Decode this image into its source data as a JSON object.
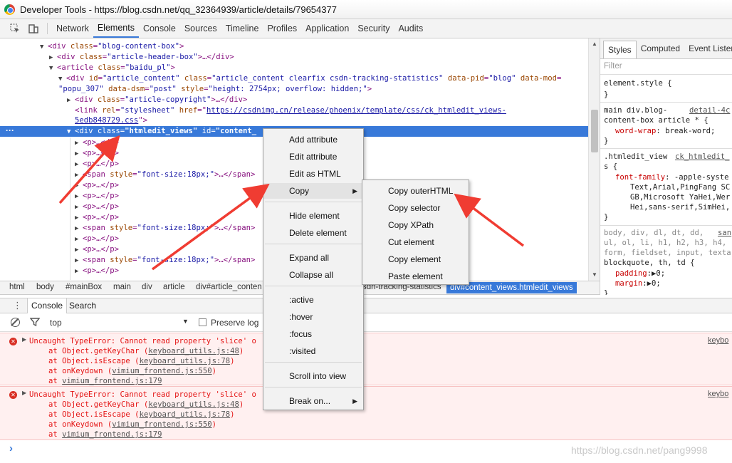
{
  "window": {
    "title": "Developer Tools - https://blog.csdn.net/qq_32364939/article/details/79654377"
  },
  "toolbar": {
    "inspect_icon": "inspect-arrow-icon",
    "device_icon": "device-mode-icon",
    "tabs": [
      "Network",
      "Elements",
      "Console",
      "Sources",
      "Timeline",
      "Profiles",
      "Application",
      "Security",
      "Audits"
    ],
    "active_tab": "Elements"
  },
  "dom": {
    "l0": {
      "tag": "<div ",
      "attr": "class",
      "val": "\"blog-content-box\"",
      "end": ">"
    },
    "l1": {
      "tag": "<div ",
      "attr": "class",
      "val": "\"article-header-box\"",
      "end": ">…</div>"
    },
    "l2": {
      "tag": "<article ",
      "attr": "class",
      "val": "\"baidu_pl\"",
      "end": ">"
    },
    "l3": {
      "tag": "<div ",
      "a1": "id",
      "v1": "\"article_content\"",
      "a2": "class",
      "v2": "\"article_content clearfix csdn-tracking-statistics\"",
      "a3": "data-pid",
      "v3": "\"blog\"",
      "a4": "data-mod",
      "v4": "="
    },
    "l3b": {
      "v": "\"popu_307\"",
      "a5": "data-dsm",
      "v5": "\"post\"",
      "a6": "style",
      "v6": "\"height: 2754px; overflow: hidden;\"",
      "end": ">"
    },
    "l4": {
      "tag": "<div ",
      "attr": "class",
      "val": "\"article-copyright\"",
      "end": ">…</div>"
    },
    "l5": {
      "tag": "<link ",
      "a1": "rel",
      "v1": "\"stylesheet\"",
      "a2": "href",
      "v2": "=\"",
      "href": "https://csdnimg.cn/release/phoenix/template/css/ck_htmledit_views-",
      "q": "\""
    },
    "l5b": {
      "href": "5edb848729.css",
      "end": "\">"
    },
    "sel": {
      "tag": "<div ",
      "a1": "class",
      "v1": "\"htmledit_views\"",
      "a2": "id",
      "v2": "\"content_"
    },
    "children": [
      {
        "type": "p",
        "text": "<p>…</p>"
      },
      {
        "type": "p",
        "text": "<p>…</p>"
      },
      {
        "type": "p",
        "text": "<p>…</p>"
      },
      {
        "type": "span",
        "tag": "<span ",
        "attr": "style",
        "val": "\"font-size:18px;\"",
        "end": ">…</span>"
      },
      {
        "type": "p",
        "text": "<p>…</p>"
      },
      {
        "type": "p",
        "text": "<p>…</p>"
      },
      {
        "type": "p",
        "text": "<p>…</p>"
      },
      {
        "type": "p",
        "text": "<p>…</p>"
      },
      {
        "type": "span",
        "tag": "<span ",
        "attr": "style",
        "val": "\"font-size:18px;\"",
        "end": ">…</span>"
      },
      {
        "type": "p",
        "text": "<p>…</p>"
      },
      {
        "type": "p",
        "text": "<p>…</p>"
      },
      {
        "type": "span",
        "tag": "<span ",
        "attr": "style",
        "val": "\"font-size:18px;\"",
        "end": ">…</span>"
      },
      {
        "type": "p",
        "text": "<p>…</p>"
      }
    ]
  },
  "breadcrumb": {
    "items": [
      "html",
      "body",
      "#mainBox",
      "main",
      "div",
      "article",
      "div#article_conten"
    ],
    "tail": "sdn-tracking-statistics",
    "active": "div#content_views.htmledit_views"
  },
  "styles": {
    "tabs": [
      "Styles",
      "Computed",
      "Event Listene"
    ],
    "filter_placeholder": "Filter",
    "r1": {
      "sel": "element.style {",
      "close": "}"
    },
    "r2": {
      "sel1": "main div.blog-",
      "src": "detail-4c",
      "sel2": "content-box article * {",
      "prop": "word-wrap",
      "val": ": break-word;",
      "close": "}"
    },
    "r3": {
      "sel1": ".htmledit_view",
      "src": "ck_htmledit_",
      "sel2": "s {",
      "prop": "font-family",
      "v1": ": -apple-syste",
      "v2": "Text,Arial,PingFang SC",
      "v3": "GB,Microsoft YaHei,Wer",
      "v4": "Hei,sans-serif,SimHei,",
      "close": "}"
    },
    "r4": {
      "s1": "body, div, dl, dt, dd,",
      "src": "san",
      "s2": "ul, ol, li, h1, h2, h3, h4,",
      "s3": "form, fieldset, input, texta",
      "s4": "blockquote, th, td {",
      "p1": "padding",
      "p1v": ":▶0;",
      "p2": "margin",
      "p2v": ":▶0;",
      "close": "}"
    }
  },
  "console": {
    "tabs": [
      "Console",
      "Search"
    ],
    "context": "top",
    "preserve_log": "Preserve log",
    "errors": [
      {
        "message": "Uncaught TypeError: Cannot read property 'slice' o",
        "frames": [
          {
            "pre": "at Object.getKeyChar (",
            "src": "keyboard_utils.js:48",
            "post": ")"
          },
          {
            "pre": "at Object.isEscape (",
            "src": "keyboard_utils.js:78",
            "post": ")"
          },
          {
            "pre": "at onKeydown (",
            "src": "vimium_frontend.js:550",
            "post": ")"
          },
          {
            "pre": "at ",
            "src": "vimium_frontend.js:179",
            "post": ""
          }
        ],
        "source": "keybo"
      },
      {
        "message": "Uncaught TypeError: Cannot read property 'slice' o",
        "frames": [
          {
            "pre": "at Object.getKeyChar (",
            "src": "keyboard_utils.js:48",
            "post": ")"
          },
          {
            "pre": "at Object.isEscape (",
            "src": "keyboard_utils.js:78",
            "post": ")"
          },
          {
            "pre": "at onKeydown (",
            "src": "vimium_frontend.js:550",
            "post": ")"
          },
          {
            "pre": "at ",
            "src": "vimium_frontend.js:179",
            "post": ""
          }
        ],
        "source": "keybo"
      }
    ],
    "prompt": "›"
  },
  "context_menu": {
    "items": [
      "Add attribute",
      "Edit attribute",
      "Edit as HTML",
      "Copy",
      "Hide element",
      "Delete element",
      "Expand all",
      "Collapse all",
      ":active",
      ":hover",
      ":focus",
      ":visited",
      "Scroll into view",
      "Break on..."
    ],
    "highlighted": "Copy"
  },
  "copy_submenu": {
    "items": [
      "Copy outerHTML",
      "Copy selector",
      "Copy XPath",
      "Cut element",
      "Copy element",
      "Paste element"
    ]
  },
  "watermark": "https://blog.csdn.net/pang9998",
  "colors": {
    "selection": "#3879d9",
    "error_bg": "#fff0f0",
    "error_text": "#e41414",
    "annotation_arrow": "#f03c32"
  }
}
